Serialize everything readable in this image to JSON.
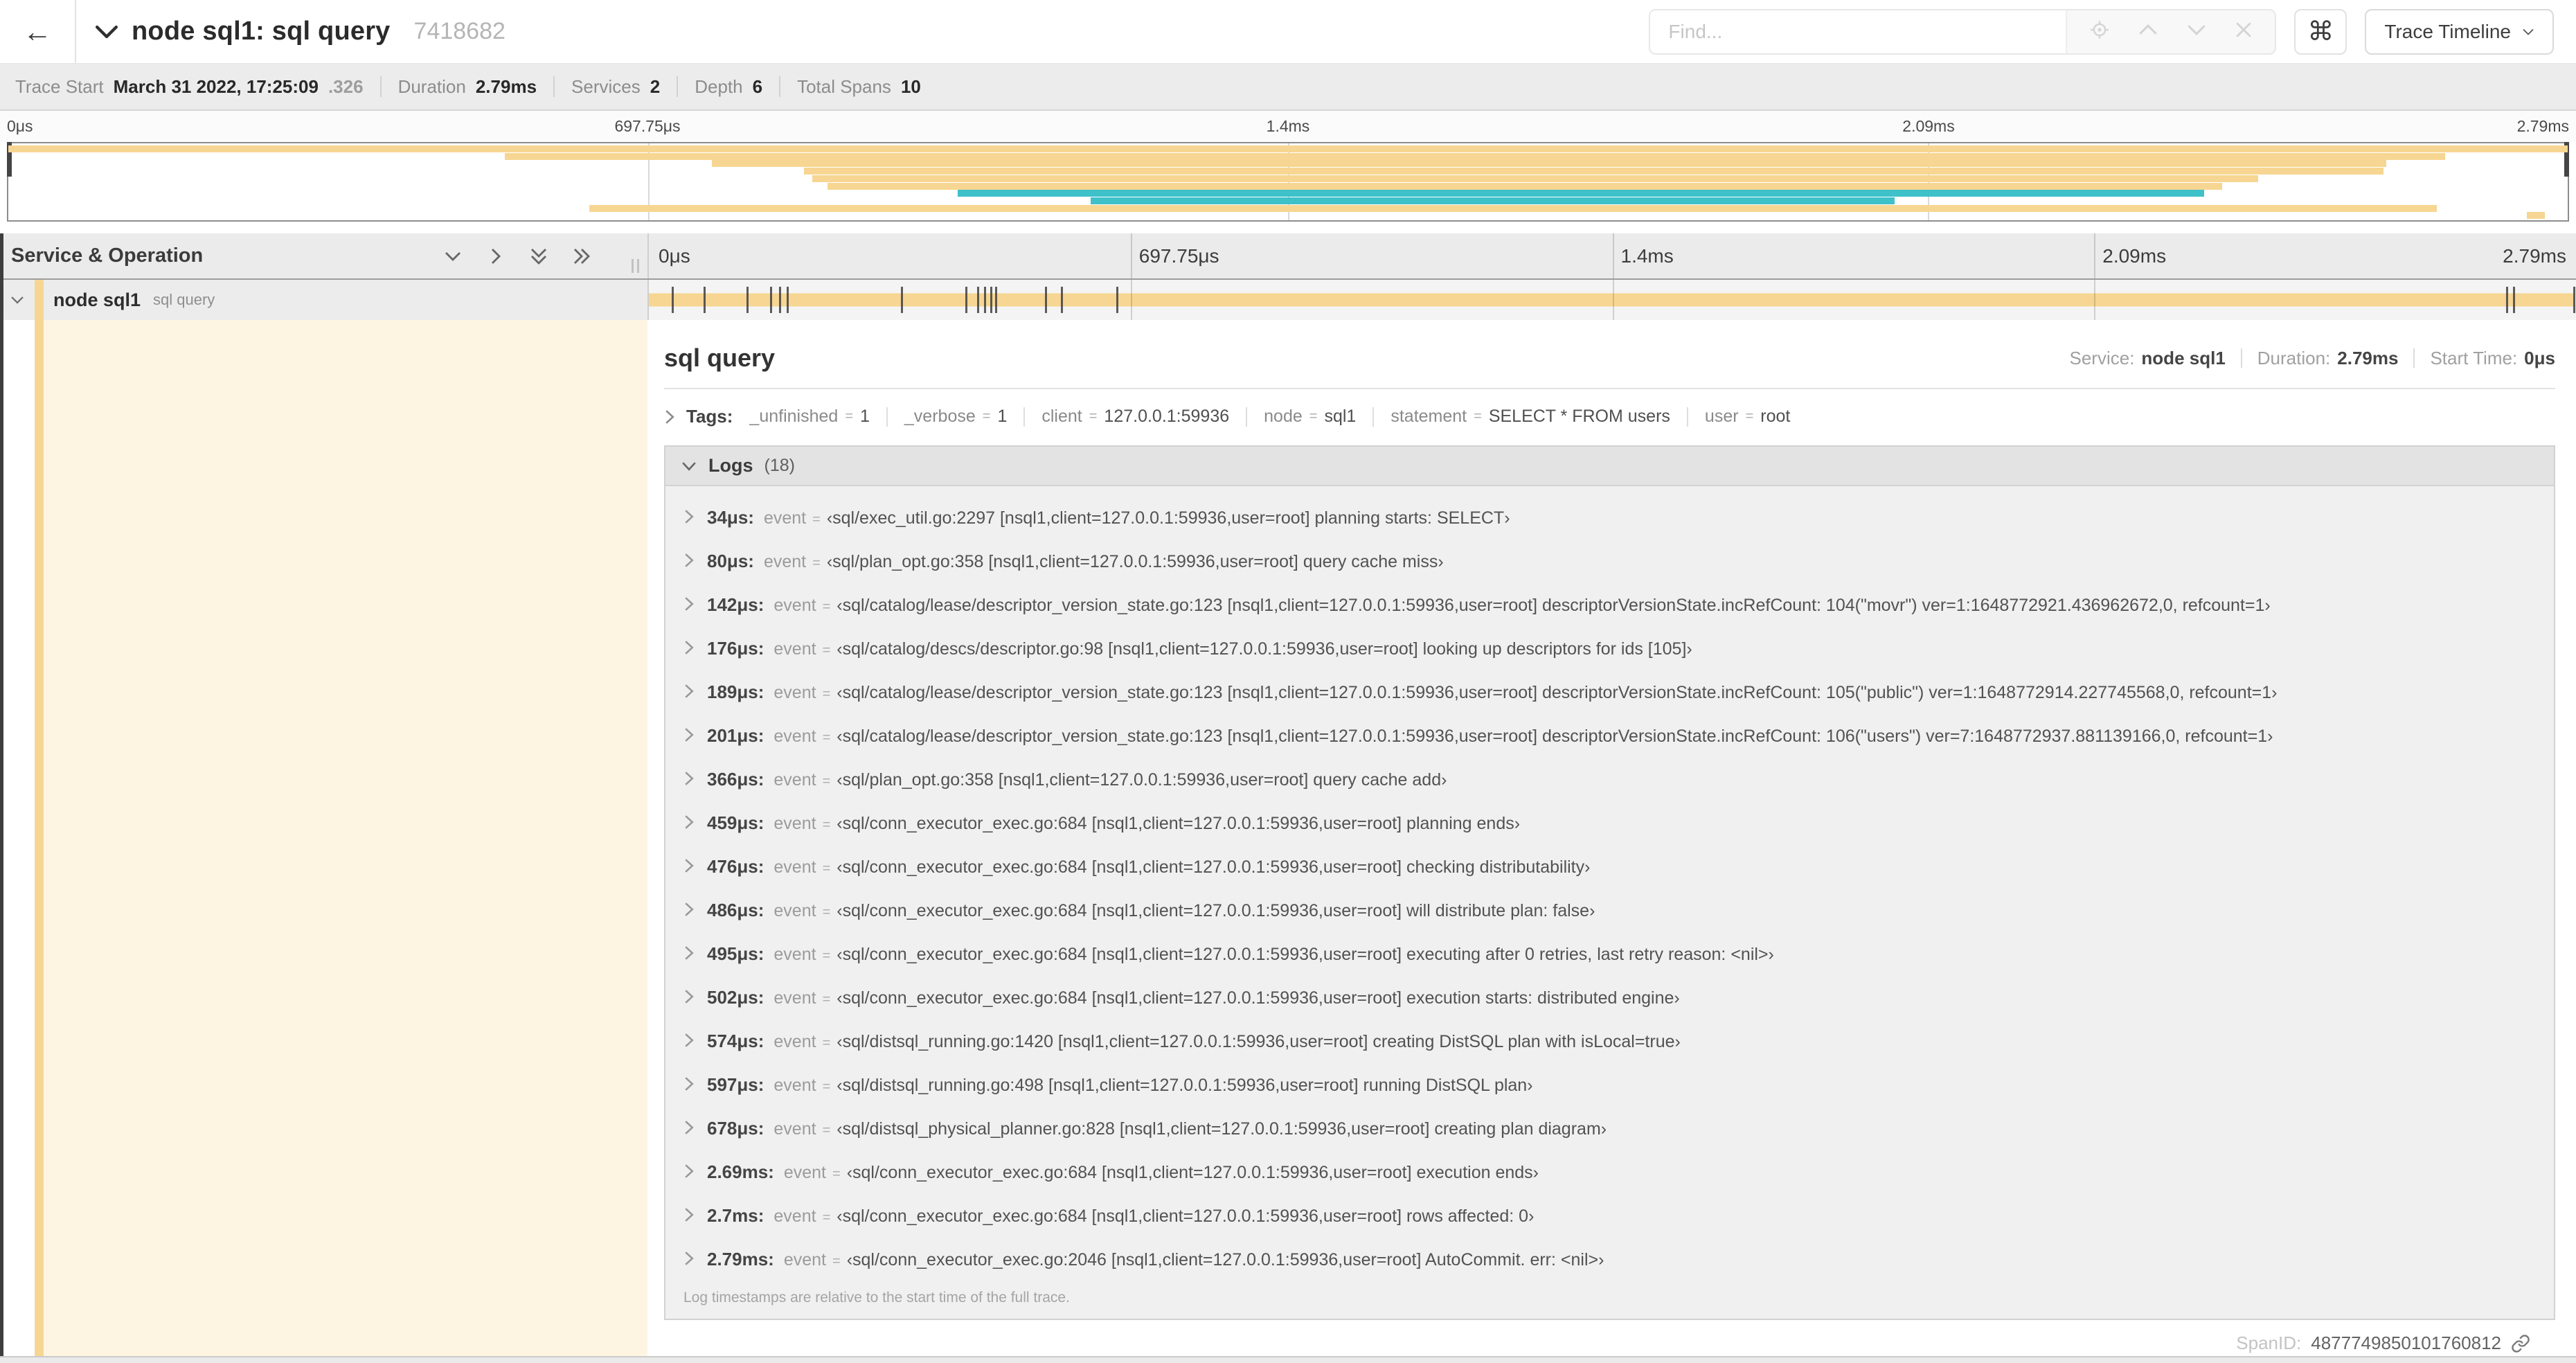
{
  "header": {
    "back_icon": "←",
    "title": "node sql1: sql query",
    "trace_id": "7418682",
    "find_placeholder": "Find...",
    "shortcut_key": "⌘",
    "view_selector_label": "Trace Timeline"
  },
  "trace_stats": {
    "items": [
      {
        "label": "Trace Start",
        "value": "March 31 2022, 17:25:09",
        "suffix": ".326"
      },
      {
        "label": "Duration",
        "value": "2.79ms"
      },
      {
        "label": "Services",
        "value": "2"
      },
      {
        "label": "Depth",
        "value": "6"
      },
      {
        "label": "Total Spans",
        "value": "10"
      }
    ]
  },
  "timeline": {
    "axis_ticks": [
      {
        "label": "0μs",
        "pos": 0
      },
      {
        "label": "697.75μs",
        "pos": 0.25
      },
      {
        "label": "1.4ms",
        "pos": 0.5
      },
      {
        "label": "2.09ms",
        "pos": 0.75
      },
      {
        "label": "2.79ms",
        "pos": 1
      }
    ],
    "gridline_positions": [
      0.25,
      0.5,
      0.75
    ],
    "colors": {
      "tan": "#F6D692",
      "teal": "#3EC1C9"
    },
    "minimap_spans": [
      {
        "start": 0.0,
        "end": 1.0,
        "color": "tan"
      },
      {
        "start": 0.194,
        "end": 0.952,
        "color": "tan"
      },
      {
        "start": 0.275,
        "end": 0.929,
        "color": "tan"
      },
      {
        "start": 0.311,
        "end": 0.928,
        "color": "tan"
      },
      {
        "start": 0.314,
        "end": 0.879,
        "color": "tan"
      },
      {
        "start": 0.32,
        "end": 0.865,
        "color": "tan"
      },
      {
        "start": 0.371,
        "end": 0.858,
        "color": "teal"
      },
      {
        "start": 0.423,
        "end": 0.737,
        "color": "teal"
      },
      {
        "start": 0.227,
        "end": 0.949,
        "color": "tan"
      },
      {
        "start": 0.984,
        "end": 0.991,
        "color": "tan"
      }
    ],
    "gantt": {
      "column_header": "Service & Operation",
      "row": {
        "service": "node sql1",
        "operation": "sql query"
      },
      "total_us": 2790,
      "log_marker_us": [
        34,
        80,
        142,
        176,
        189,
        201,
        366,
        459,
        476,
        486,
        495,
        502,
        574,
        597,
        678,
        2690,
        2700,
        2790
      ]
    }
  },
  "detail": {
    "title": "sql query",
    "meta": [
      {
        "label": "Service:",
        "value": "node sql1"
      },
      {
        "label": "Duration:",
        "value": "2.79ms"
      },
      {
        "label": "Start Time:",
        "value": "0μs"
      }
    ],
    "tags_label": "Tags:",
    "eq": "=",
    "tags": [
      {
        "key": "_unfinished",
        "value": "1"
      },
      {
        "key": "_verbose",
        "value": "1"
      },
      {
        "key": "client",
        "value": "127.0.0.1:59936"
      },
      {
        "key": "node",
        "value": "sql1"
      },
      {
        "key": "statement",
        "value": "SELECT * FROM users"
      },
      {
        "key": "user",
        "value": "root"
      }
    ],
    "logs_label": "Logs",
    "logs_count": "(18)",
    "log_field": "event",
    "logs": [
      {
        "time": "34μs:",
        "value": "‹sql/exec_util.go:2297 [nsql1,client=127.0.0.1:59936,user=root] planning starts: SELECT›"
      },
      {
        "time": "80μs:",
        "value": "‹sql/plan_opt.go:358 [nsql1,client=127.0.0.1:59936,user=root] query cache miss›"
      },
      {
        "time": "142μs:",
        "value": "‹sql/catalog/lease/descriptor_version_state.go:123 [nsql1,client=127.0.0.1:59936,user=root] descriptorVersionState.incRefCount: 104(\"movr\") ver=1:1648772921.436962672,0, refcount=1›"
      },
      {
        "time": "176μs:",
        "value": "‹sql/catalog/descs/descriptor.go:98 [nsql1,client=127.0.0.1:59936,user=root] looking up descriptors for ids [105]›"
      },
      {
        "time": "189μs:",
        "value": "‹sql/catalog/lease/descriptor_version_state.go:123 [nsql1,client=127.0.0.1:59936,user=root] descriptorVersionState.incRefCount: 105(\"public\") ver=1:1648772914.227745568,0, refcount=1›"
      },
      {
        "time": "201μs:",
        "value": "‹sql/catalog/lease/descriptor_version_state.go:123 [nsql1,client=127.0.0.1:59936,user=root] descriptorVersionState.incRefCount: 106(\"users\") ver=7:1648772937.881139166,0, refcount=1›"
      },
      {
        "time": "366μs:",
        "value": "‹sql/plan_opt.go:358 [nsql1,client=127.0.0.1:59936,user=root] query cache add›"
      },
      {
        "time": "459μs:",
        "value": "‹sql/conn_executor_exec.go:684 [nsql1,client=127.0.0.1:59936,user=root] planning ends›"
      },
      {
        "time": "476μs:",
        "value": "‹sql/conn_executor_exec.go:684 [nsql1,client=127.0.0.1:59936,user=root] checking distributability›"
      },
      {
        "time": "486μs:",
        "value": "‹sql/conn_executor_exec.go:684 [nsql1,client=127.0.0.1:59936,user=root] will distribute plan: false›"
      },
      {
        "time": "495μs:",
        "value": "‹sql/conn_executor_exec.go:684 [nsql1,client=127.0.0.1:59936,user=root] executing after 0 retries, last retry reason: <nil>›"
      },
      {
        "time": "502μs:",
        "value": "‹sql/conn_executor_exec.go:684 [nsql1,client=127.0.0.1:59936,user=root] execution starts: distributed engine›"
      },
      {
        "time": "574μs:",
        "value": "‹sql/distsql_running.go:1420 [nsql1,client=127.0.0.1:59936,user=root] creating DistSQL plan with isLocal=true›"
      },
      {
        "time": "597μs:",
        "value": "‹sql/distsql_running.go:498 [nsql1,client=127.0.0.1:59936,user=root] running DistSQL plan›"
      },
      {
        "time": "678μs:",
        "value": "‹sql/distsql_physical_planner.go:828 [nsql1,client=127.0.0.1:59936,user=root] creating plan diagram›"
      },
      {
        "time": "2.69ms:",
        "value": "‹sql/conn_executor_exec.go:684 [nsql1,client=127.0.0.1:59936,user=root] execution ends›"
      },
      {
        "time": "2.7ms:",
        "value": "‹sql/conn_executor_exec.go:684 [nsql1,client=127.0.0.1:59936,user=root] rows affected: 0›"
      },
      {
        "time": "2.79ms:",
        "value": "‹sql/conn_executor_exec.go:2046 [nsql1,client=127.0.0.1:59936,user=root] AutoCommit. err: <nil>›"
      }
    ],
    "logs_footer": "Log timestamps are relative to the start time of the full trace.",
    "span_id_label": "SpanID:",
    "span_id": "4877749850101760812"
  }
}
